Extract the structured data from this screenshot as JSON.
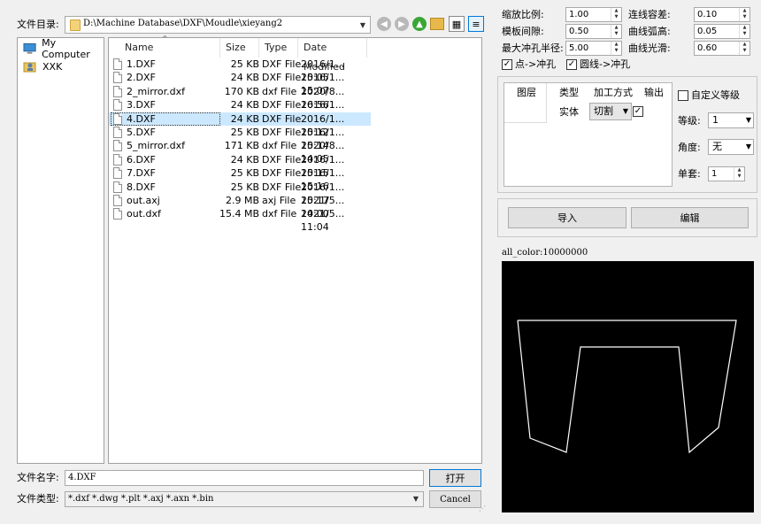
{
  "dialog": {
    "dir_label": "文件目录:",
    "path": "D:\\Machine Database\\DXF\\Moudle\\xieyang2",
    "sidebar": [
      {
        "label": "My Computer",
        "icon": "computer-icon"
      },
      {
        "label": "XXK",
        "icon": "user-folder-icon"
      }
    ],
    "columns": [
      "Name",
      "Size",
      "Type",
      "Date Modified"
    ],
    "files": [
      {
        "name": "1.DXF",
        "size": "25 KB",
        "type": "DXF File",
        "date": "2016/1...",
        "time": "15:05"
      },
      {
        "name": "2.DXF",
        "size": "24 KB",
        "type": "DXF File",
        "date": "2016/1...",
        "time": "15:07"
      },
      {
        "name": "2_mirror.dxf",
        "size": "170 KB",
        "type": "dxf File",
        "date": "2020/8...",
        "time": "16:56"
      },
      {
        "name": "3.DXF",
        "size": "24 KB",
        "type": "DXF File",
        "date": "2016/1...",
        "time": "15:11"
      },
      {
        "name": "4.DXF",
        "size": "24 KB",
        "type": "DXF File",
        "date": "2016/1...",
        "time": "15:12"
      },
      {
        "name": "5.DXF",
        "size": "25 KB",
        "type": "DXF File",
        "date": "2016/1...",
        "time": "15:14"
      },
      {
        "name": "5_mirror.dxf",
        "size": "171 KB",
        "type": "dxf File",
        "date": "2020/8...",
        "time": "14:05"
      },
      {
        "name": "6.DXF",
        "size": "24 KB",
        "type": "DXF File",
        "date": "2016/1...",
        "time": "15:15"
      },
      {
        "name": "7.DXF",
        "size": "25 KB",
        "type": "DXF File",
        "date": "2016/1...",
        "time": "15:16"
      },
      {
        "name": "8.DXF",
        "size": "25 KB",
        "type": "DXF File",
        "date": "2016/1...",
        "time": "15:17"
      },
      {
        "name": "out.axj",
        "size": "2.9 MB",
        "type": "axj File",
        "date": "2021/5...",
        "time": "14:00"
      },
      {
        "name": "out.dxf",
        "size": "15.4 MB",
        "type": "dxf File",
        "date": "2021/5...",
        "time": "11:04"
      }
    ],
    "selected_index": 4,
    "filename_label": "文件名字:",
    "filename_value": "4.DXF",
    "filetype_label": "文件类型:",
    "filetype_value": "*.dxf *.dwg *.plt *.axj *.axn *.bin",
    "open_button": "打开",
    "cancel_button": "Cancel"
  },
  "params": {
    "scale_label": "缩放比例:",
    "scale_value": "1.00",
    "template_gap_label": "模板间隙:",
    "template_gap_value": "0.50",
    "max_punch_radius_label": "最大冲孔半径:",
    "max_punch_radius_value": "5.00",
    "connect_tol_label": "连线容差:",
    "connect_tol_value": "0.10",
    "arc_height_label": "曲线弧高:",
    "arc_height_value": "0.05",
    "smooth_label": "曲线光滑:",
    "smooth_value": "0.60",
    "point_punch_label": "点->冲孔",
    "point_punch_checked": true,
    "circle_punch_label": "圆线->冲孔",
    "circle_punch_checked": true
  },
  "layer_table": {
    "headers": [
      "图层",
      "类型",
      "加工方式",
      "输出"
    ],
    "row": {
      "type": "实体",
      "process": "切割",
      "output_checked": true
    }
  },
  "grade": {
    "custom_label": "自定义等级",
    "custom_checked": false,
    "level_label": "等级:",
    "level_value": "1",
    "angle_label": "角度:",
    "angle_value": "无",
    "single_label": "单套:",
    "single_value": "1"
  },
  "actions": {
    "import_button": "导入",
    "edit_button": "编辑"
  },
  "preview": {
    "color_text": "all_color:10000000"
  },
  "colors": {
    "selection": "#cce8ff",
    "focus_border": "#0078d7",
    "preview_bg": "#000000",
    "preview_line": "#ffffff"
  }
}
